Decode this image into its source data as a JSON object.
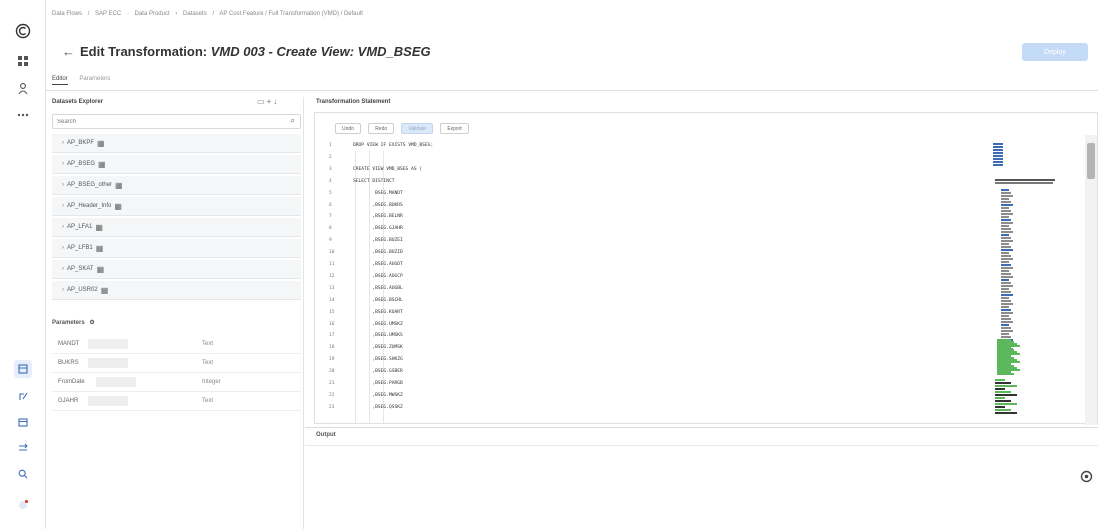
{
  "rail": {
    "icons": [
      "app-logo-icon",
      "grid-icon",
      "user-icon",
      "more-icon",
      "data-builder-icon",
      "share-icon",
      "database-icon",
      "transform-icon",
      "search-icon",
      "notification-icon"
    ]
  },
  "breadcrumb": [
    "Data Flows",
    "/",
    "SAP ECC",
    "·",
    "Data Product",
    "›",
    "Datasets",
    "/",
    "AP Cost Feature / Full Transformation (VMD) / Default"
  ],
  "header": {
    "back_glyph": "←",
    "title_prefix": "Edit Transformation:",
    "title_italic": "VMD 003 - Create View: VMD_BSEG",
    "deploy_label": "Deploy"
  },
  "tabs": [
    {
      "label": "Editor",
      "active": true
    },
    {
      "label": "Parameters",
      "active": false
    }
  ],
  "explorer": {
    "title": "Datasets Explorer",
    "search_placeholder": "Search",
    "items": [
      {
        "label": "AP_BKPF"
      },
      {
        "label": "AP_BSEG"
      },
      {
        "label": "AP_BSEG_other"
      },
      {
        "label": "AP_Header_Info"
      },
      {
        "label": "AP_LFA1"
      },
      {
        "label": "AP_LFB1"
      },
      {
        "label": "AP_SKAT"
      },
      {
        "label": "AP_USR02"
      }
    ]
  },
  "parameters": {
    "title": "Parameters",
    "rows": [
      {
        "name": "MANDT",
        "type": "Text"
      },
      {
        "name": "BUKRS",
        "type": "Text"
      },
      {
        "name": "FromDate",
        "type": "Integer"
      },
      {
        "name": "GJAHR",
        "type": "Text"
      }
    ]
  },
  "editor": {
    "title": "Transformation Statement",
    "buttons": [
      "Undo",
      "Redo",
      "Validate",
      "Export"
    ],
    "primary_button": "Validate",
    "lines": [
      "DROP VIEW IF EXISTS VMD_BSEG;",
      "",
      "CREATE VIEW VMD_BSEG AS (",
      "SELECT DISTINCT",
      "        BSEG.MANDT",
      "       ,BSEG.BUKRS",
      "       ,BSEG.BELNR",
      "       ,BSEG.GJAHR",
      "       ,BSEG.BUZEI",
      "       ,BSEG.BUZID",
      "       ,BSEG.AUGDT",
      "       ,BSEG.AUGCP",
      "       ,BSEG.AUGBL",
      "       ,BSEG.BSCHL",
      "       ,BSEG.KOART",
      "       ,BSEG.UMSKZ",
      "       ,BSEG.UMSKS",
      "       ,BSEG.ZUMSK",
      "       ,BSEG.SHKZG",
      "       ,BSEG.GSBER",
      "       ,BSEG.PARGB",
      "       ,BSEG.MWSKZ",
      "       ,BSEG.QSSKZ"
    ]
  },
  "output": {
    "title": "Output"
  },
  "colors": {
    "accent_light": "#c4dbf7",
    "minimap_green": "#5cb85c",
    "minimap_blue": "#3d6cb5"
  }
}
